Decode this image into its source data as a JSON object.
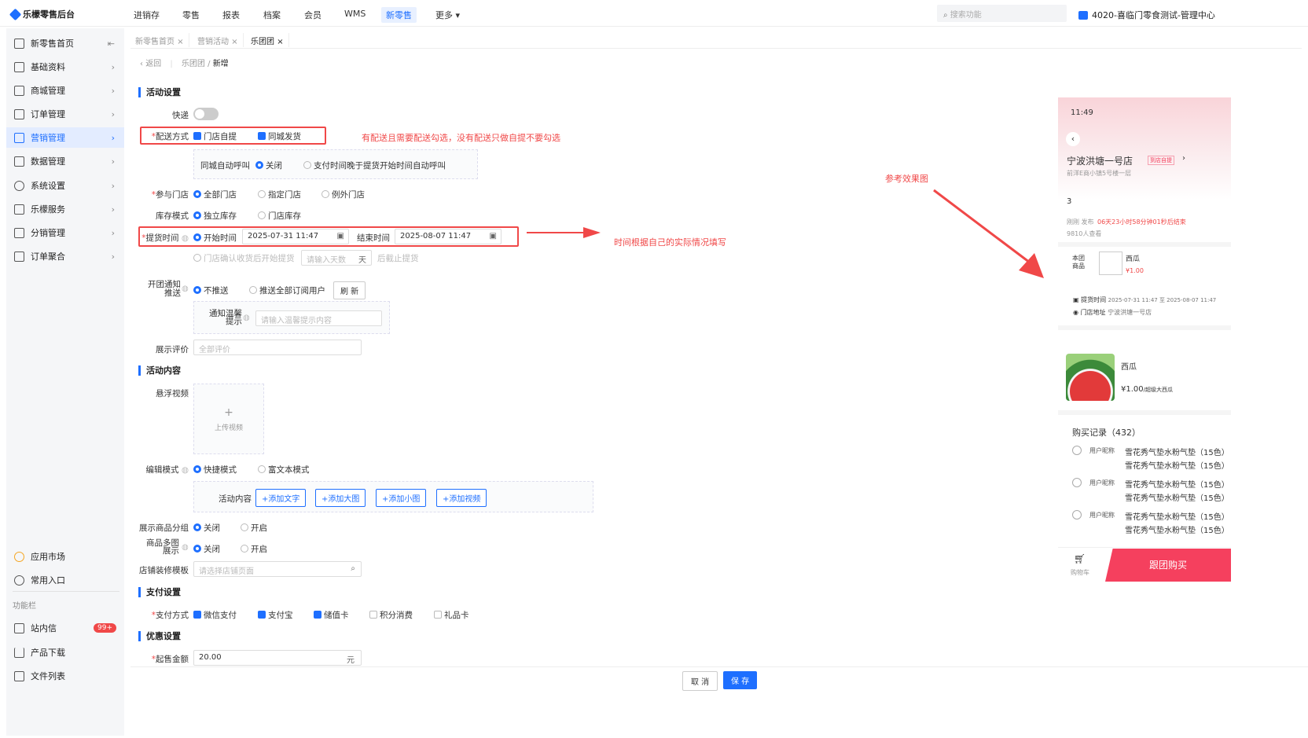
{
  "app": {
    "title": "乐檬零售后台"
  },
  "topnav": {
    "items": [
      "进销存",
      "零售",
      "报表",
      "档案",
      "会员",
      "WMS",
      "新零售",
      "更多"
    ],
    "active": "新零售",
    "search_placeholder": "搜索功能",
    "org": "4020-喜临门零食测试-管理中心"
  },
  "sidebar": {
    "items": [
      "新零售首页",
      "基础资料",
      "商城管理",
      "订单管理",
      "营销管理",
      "数据管理",
      "系统设置",
      "乐檬服务",
      "分销管理",
      "订单聚合"
    ],
    "active": "营销管理",
    "bottom_items": [
      "应用市场",
      "常用入口"
    ],
    "section_label": "功能栏",
    "tool_items": [
      "站内信",
      "产品下载",
      "文件列表"
    ],
    "message_badge": "99+"
  },
  "tabs": [
    "新零售首页",
    "营销活动",
    "乐团团"
  ],
  "active_tab": "乐团团",
  "breadcrumb": {
    "back": "返回",
    "parent": "乐团团",
    "current": "新增"
  },
  "form": {
    "section_activity": "活动设置",
    "express_label": "快递",
    "delivery_label": "配送方式",
    "delivery_options": [
      "门店自提",
      "同城发货"
    ],
    "auto_call_label": "同城自动呼叫",
    "auto_call_options": [
      "关闭",
      "支付时间晚于提货开始时间自动呼叫"
    ],
    "stores_label": "参与门店",
    "stores_options": [
      "全部门店",
      "指定门店",
      "例外门店"
    ],
    "stock_label": "库存模式",
    "stock_options": [
      "独立库存",
      "门店库存"
    ],
    "pickup_label": "提货时间",
    "start_label": "开始时间",
    "start_value": "2025-07-31 11:47",
    "end_label": "结束时间",
    "end_value": "2025-08-07 11:47",
    "confirm_option": "门店确认收货后开始提货",
    "days_placeholder": "请输入天数",
    "days_unit": "天",
    "days_suffix": "后截止提货",
    "notify_label": "开团通知推送",
    "notify_options": [
      "不推送",
      "推送全部订阅用户"
    ],
    "refresh": "刷 新",
    "tip_label": "通知温馨提示",
    "tip_placeholder": "请输入温馨提示内容",
    "review_label": "展示评价",
    "review_placeholder": "全部评价",
    "section_content": "活动内容",
    "video_label": "悬浮视频",
    "upload_label": "上传视频",
    "edit_mode_label": "编辑模式",
    "edit_mode_options": [
      "快捷模式",
      "富文本模式"
    ],
    "content_label": "活动内容",
    "content_buttons": [
      "+添加文字",
      "+添加大图",
      "+添加小图",
      "+添加视频"
    ],
    "group_label": "展示商品分组",
    "group_options": [
      "关闭",
      "开启"
    ],
    "multi_img_label": "商品多图展示",
    "multi_img_options": [
      "关闭",
      "开启"
    ],
    "template_label": "店铺装修模板",
    "template_placeholder": "请选择店铺页面",
    "section_pay": "支付设置",
    "pay_label": "支付方式",
    "pay_options": [
      "微信支付",
      "支付宝",
      "储值卡",
      "积分消费",
      "礼品卡"
    ],
    "pay_checked": [
      true,
      true,
      true,
      false,
      false
    ],
    "section_discount": "优惠设置",
    "min_amount_label": "起售金额",
    "min_amount_value": "20.00",
    "min_amount_unit": "元"
  },
  "footer": {
    "cancel": "取 消",
    "save": "保 存"
  },
  "annotations": {
    "delivery_note": "有配送且需要配送勾选，没有配送只做自提不要勾选",
    "time_note": "时间根据自己的实际情况填写",
    "ref_note": "参考效果图"
  },
  "preview": {
    "time": "11:49",
    "store_name": "宁波洪塘一号店",
    "store_tag": "到店自提",
    "address_line": "前洋E商小镇5号楼一层",
    "number": "3",
    "publisher": "刚刚 发布",
    "countdown": "06天23小时58分钟01秒后结束",
    "views": "9810人查看",
    "this_group": "本团商品",
    "product_name": "西瓜",
    "product_price": "¥1.00",
    "pickup_time_label": "提货时间",
    "pickup_time": "2025-07-31 11:47 至 2025-08-07 11:47",
    "store_addr_label": "门店地址",
    "store_addr": "宁波洪塘一号店",
    "item_name": "西瓜",
    "item_price": "¥1.00",
    "item_sub": "/超级大西瓜",
    "records_title": "购买记录（432）",
    "user_label": "用户昵称",
    "record_text": "雪花秀气垫水粉气垫（15色）",
    "cart_label": "购物车",
    "buy_button": "跟团购买"
  },
  "colors": {
    "accent": "#1e6fff",
    "danger": "#f04848",
    "buy": "#f5405e"
  }
}
